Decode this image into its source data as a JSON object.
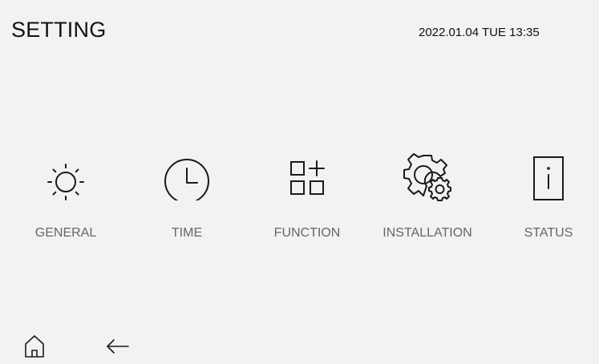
{
  "header": {
    "title": "SETTING",
    "datetime": "2022.01.04 TUE 13:35"
  },
  "menu": {
    "items": [
      {
        "label": "GENERAL",
        "icon": "sun-icon"
      },
      {
        "label": "TIME",
        "icon": "clock-icon"
      },
      {
        "label": "FUNCTION",
        "icon": "apps-grid-icon"
      },
      {
        "label": "INSTALLATION",
        "icon": "gear-icon"
      },
      {
        "label": "STATUS",
        "icon": "info-icon"
      }
    ]
  },
  "footer": {
    "home_icon": "home-icon",
    "back_icon": "back-arrow-icon"
  },
  "colors": {
    "background": "#f2f2f2",
    "text": "#111111",
    "label": "#666666",
    "icon_stroke": "#1a1a1a"
  }
}
